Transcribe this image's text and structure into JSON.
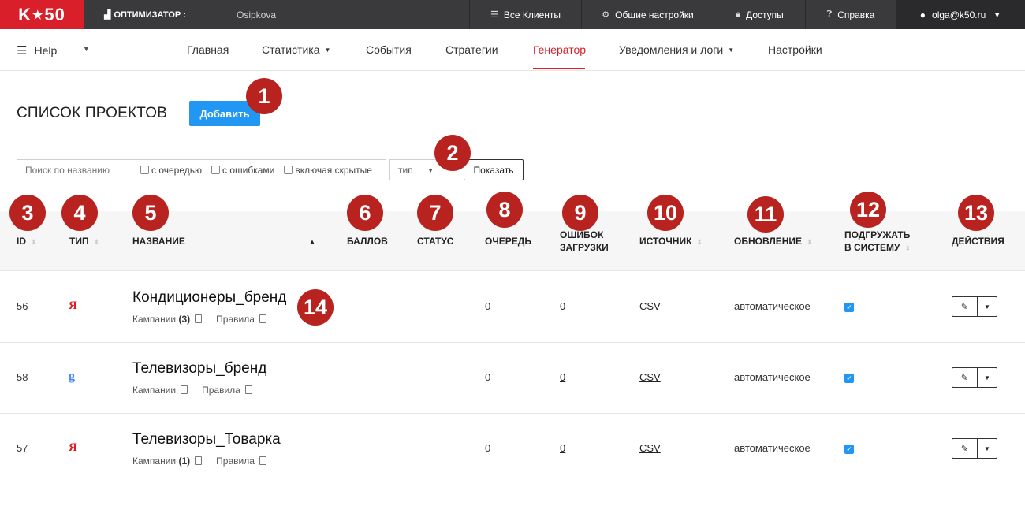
{
  "topbar": {
    "logo_text": "K50",
    "optimizer_label": "ОПТИМИЗАТОР :",
    "optimizer_value": "Osipkova",
    "items": [
      {
        "label": "Все Клиенты",
        "icon": "list-icon"
      },
      {
        "label": "Общие настройки",
        "icon": "gear-icon"
      },
      {
        "label": "Доступы",
        "icon": "lock-icon"
      },
      {
        "label": "Справка",
        "icon": "question-icon"
      }
    ],
    "user": "olga@k50.ru"
  },
  "nav": {
    "help": "Help",
    "items": [
      {
        "label": "Главная"
      },
      {
        "label": "Статистика"
      },
      {
        "label": "События"
      },
      {
        "label": "Стратегии"
      },
      {
        "label": "Генератор",
        "active": true
      },
      {
        "label": "Уведомления и логи"
      },
      {
        "label": "Настройки"
      }
    ]
  },
  "page": {
    "title": "СПИСОК ПРОЕКТОВ",
    "add_label": "Добавить"
  },
  "filters": {
    "search_placeholder": "Поиск по названию",
    "check_queue": "с очередью",
    "check_errors": "с ошибками",
    "check_hidden": "включая скрытые",
    "type_value": "тип",
    "show_label": "Показать"
  },
  "table": {
    "headers": {
      "id": "ID",
      "type": "ТИП",
      "name": "НАЗВАНИЕ",
      "points": "БАЛЛОВ",
      "status": "СТАТУС",
      "queue": "ОЧЕРЕДЬ",
      "errors_1": "ОШИБОК",
      "errors_2": "ЗАГРУЗКИ",
      "source": "ИСТОЧНИК",
      "update": "ОБНОВЛЕНИЕ",
      "load_1": "ПОДГРУЖАТЬ",
      "load_2": "В СИСТЕМУ",
      "actions": "ДЕЙСТВИЯ"
    },
    "rows": [
      {
        "id": "56",
        "type_letter": "Я",
        "name": "Кондиционеры_бренд",
        "campaigns": "Кампании",
        "campaigns_count": "(3)",
        "rules": "Правила",
        "queue": "0",
        "errors": "0",
        "source": "CSV",
        "update": "автоматическое",
        "load": true
      },
      {
        "id": "58",
        "type_letter": "g",
        "name": "Телевизоры_бренд",
        "campaigns": "Кампании",
        "campaigns_count": "",
        "rules": "Правила",
        "queue": "0",
        "errors": "0",
        "source": "CSV",
        "update": "автоматическое",
        "load": true
      },
      {
        "id": "57",
        "type_letter": "Я",
        "name": "Телевизоры_Товарка",
        "campaigns": "Кампании",
        "campaigns_count": "(1)",
        "rules": "Правила",
        "queue": "0",
        "errors": "0",
        "source": "CSV",
        "update": "автоматическое",
        "load": true
      }
    ]
  },
  "badges": [
    "1",
    "2",
    "3",
    "4",
    "5",
    "6",
    "7",
    "8",
    "9",
    "10",
    "11",
    "12",
    "13",
    "14"
  ],
  "colors": {
    "brand": "#d9202a",
    "accent": "#2196f3",
    "badge": "#b8231f",
    "topbar": "#3a3a3c"
  }
}
